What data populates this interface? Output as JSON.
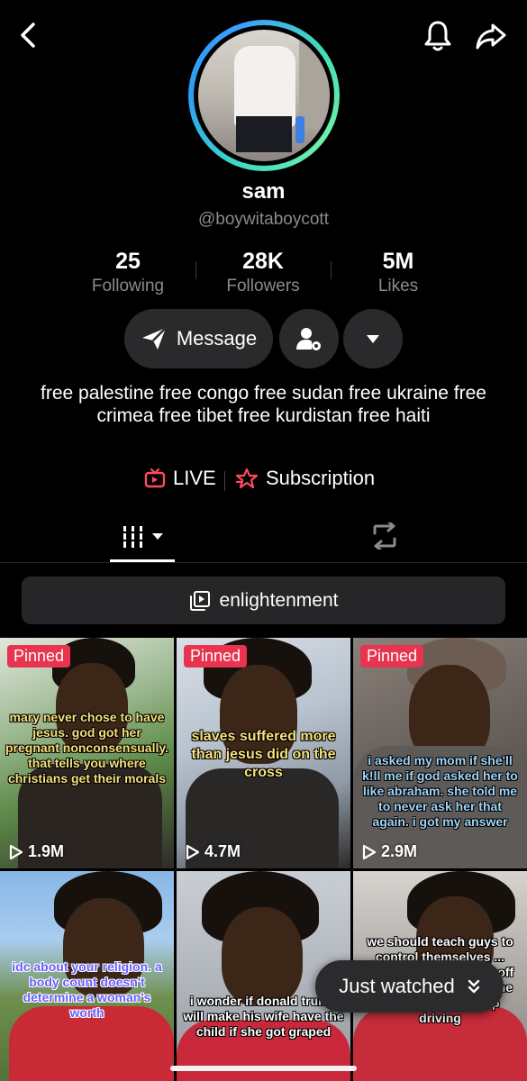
{
  "profile": {
    "display_name": "sam",
    "username": "@boywitaboycott",
    "stats": [
      {
        "value": "25",
        "label": "Following"
      },
      {
        "value": "28K",
        "label": "Followers"
      },
      {
        "value": "5M",
        "label": "Likes"
      }
    ],
    "bio": "free palestine free congo free sudan free ukraine free crimea free tibet free kurdistan free haiti"
  },
  "actions": {
    "message_label": "Message",
    "add_friend_icon": "person-gear-icon",
    "more_icon": "triangle-down-icon"
  },
  "links": {
    "live_label": "LIVE",
    "subscription_label": "Subscription"
  },
  "playlist": {
    "label": "enlightenment"
  },
  "videos": [
    {
      "pinned": "Pinned",
      "caption": "mary never chose to have jesus. god got her pregnant nonconsensually. that tells you where christians get their morals",
      "views": "1.9M"
    },
    {
      "pinned": "Pinned",
      "caption": "slaves suffered more than jesus did on the cross",
      "views": "4.7M"
    },
    {
      "pinned": "Pinned",
      "caption": "i asked my mom if she'll k!ll me if god asked her to like abraham. she told me to never ask her that again. i got my answer",
      "views": "2.9M"
    },
    {
      "pinned": "",
      "caption": "idc about your religion. a body count doesn't determine a woman's worth",
      "views": ""
    },
    {
      "pinned": "",
      "caption": "i wonder if donald trump will make his wife have the child if she got graped",
      "views": ""
    },
    {
      "pinned": "",
      "caption": "we should teach guys to control themselves ... everyone else to stay off the roads. you teach the drunk driver to stop driving",
      "views": ""
    }
  ],
  "floating": {
    "just_watched_label": "Just watched"
  },
  "colors": {
    "background": "#000000",
    "pill": "#2a2a2c",
    "pinned_badge": "#e8344e",
    "live_icon": "#ff4b5c",
    "muted_text": "#8a8a8f"
  }
}
